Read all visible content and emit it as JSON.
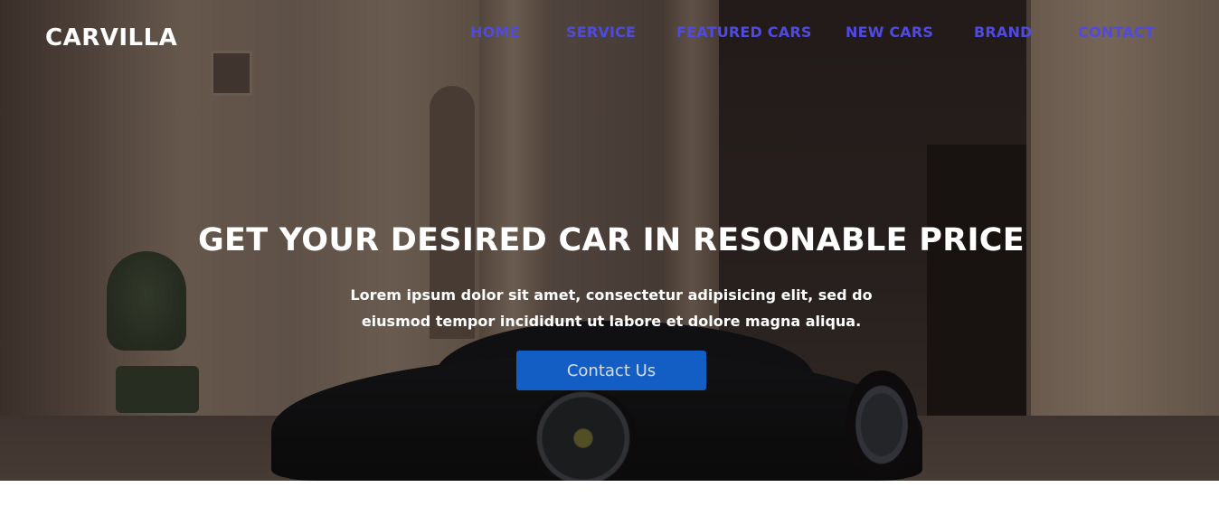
{
  "header": {
    "logo": "CARVILLA",
    "nav": [
      {
        "label": "HOME"
      },
      {
        "label": "SERVICE"
      },
      {
        "label": "FEATURED CARS"
      },
      {
        "label": "NEW CARS"
      },
      {
        "label": "BRAND"
      },
      {
        "label": "CONTACT"
      }
    ]
  },
  "hero": {
    "headline": "GET YOUR DESIRED CAR IN RESONABLE PRICE",
    "subtext": "Lorem ipsum dolor sit amet, consectetur adipisicing elit, sed do eiusmod tempor incididunt ut labore et dolore magna aliqua.",
    "cta_label": "Contact Us"
  },
  "colors": {
    "nav_link": "#4f4ae0",
    "cta_background": "#1465d4",
    "text": "#ffffff"
  }
}
